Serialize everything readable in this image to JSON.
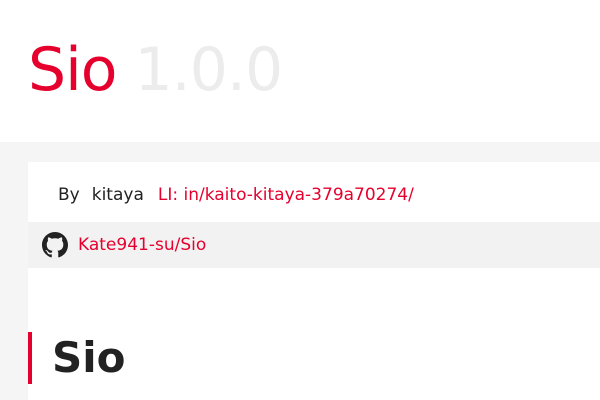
{
  "header": {
    "package_name": "Sio",
    "version": "1.0.0"
  },
  "author": {
    "by_label": "By",
    "name": "kitaya",
    "linkedin_text": "LI: in/kaito-kitaya-379a70274/"
  },
  "repository": {
    "icon": "github-icon",
    "link_text": "Kate941-su/Sio"
  },
  "readme": {
    "heading": "Sio"
  },
  "colors": {
    "accent": "#e6002d",
    "version": "#ececec",
    "band": "#f5f5f5",
    "repo_row": "#f2f2f2",
    "text": "#222222"
  }
}
